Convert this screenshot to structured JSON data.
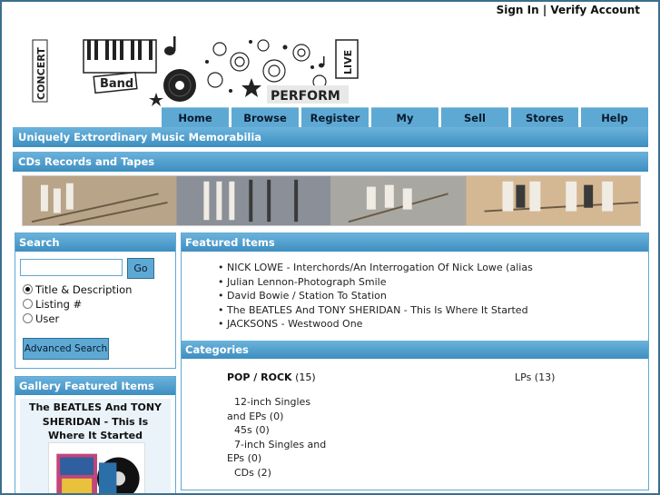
{
  "header": {
    "sign_in": "Sign In",
    "separator": " | ",
    "verify_account": "Verify Account",
    "logo_words": [
      "CONCERT",
      "Band",
      "LIVE",
      "PERFORM"
    ]
  },
  "nav": {
    "tabs": [
      {
        "label": "Home"
      },
      {
        "label": "Browse"
      },
      {
        "label": "Register"
      },
      {
        "label": "My Account"
      },
      {
        "label": "Sell"
      },
      {
        "label": "Stores"
      },
      {
        "label": "Help"
      }
    ]
  },
  "tagline": "Uniquely Extrordinary Music Memorabilia",
  "section_title": "CDs Records and Tapes",
  "search": {
    "title": "Search",
    "input_value": "",
    "go_label": "Go",
    "options": [
      {
        "label": "Title & Description",
        "checked": true
      },
      {
        "label": "Listing #",
        "checked": false
      },
      {
        "label": "User",
        "checked": false
      }
    ],
    "advanced_label": "Advanced Search"
  },
  "gallery": {
    "title": "Gallery Featured Items",
    "item_title": "The BEATLES And TONY SHERIDAN - This Is Where It Started"
  },
  "featured": {
    "title": "Featured Items",
    "items": [
      "• NICK LOWE - Interchords/An Interrogation Of Nick Lowe (alias",
      "• Julian Lennon-Photograph Smile",
      "• David Bowie / Station To Station",
      "• The BEATLES And TONY SHERIDAN - This Is Where It Started",
      "• JACKSONS - Westwood One"
    ]
  },
  "categories": {
    "title": "Categories",
    "main": {
      "name": "POP / ROCK",
      "count": " (15)"
    },
    "right": "LPs (13)",
    "subcats": [
      {
        "line1": "12-inch Singles",
        "line2": "and EPs (0)"
      },
      {
        "line1": "45s (0)",
        "line2": ""
      },
      {
        "line1": "7-inch Singles and",
        "line2": "EPs (0)"
      },
      {
        "line1": "CDs (2)",
        "line2": ""
      }
    ]
  },
  "colors": {
    "accent": "#5ea9d3",
    "bar_top": "#6bb3dc",
    "bar_bottom": "#3d8ec0",
    "page_border": "#3d6f8e"
  }
}
